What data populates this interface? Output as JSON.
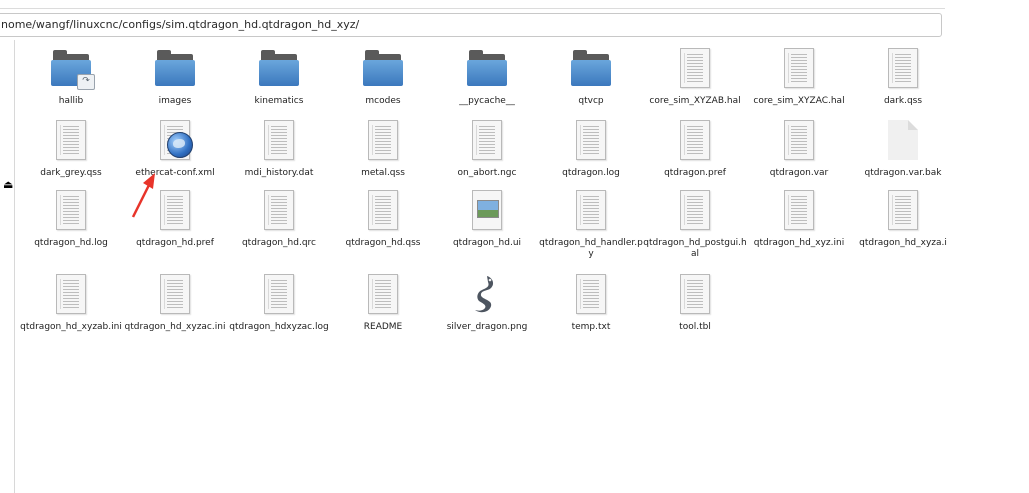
{
  "path": "nome/wangf/linuxcnc/configs/sim.qtdragon_hd.qtdragon_hd_xyz/",
  "sidebar": {
    "eject_symbol": "⏏"
  },
  "files": [
    {
      "name": "hallib",
      "icon": "folder-link-icon"
    },
    {
      "name": "images",
      "icon": "folder-icon"
    },
    {
      "name": "kinematics",
      "icon": "folder-icon"
    },
    {
      "name": "mcodes",
      "icon": "folder-icon"
    },
    {
      "name": "__pycache__",
      "icon": "folder-icon"
    },
    {
      "name": "qtvcp",
      "icon": "folder-icon"
    },
    {
      "name": "core_sim_XYZAB.hal",
      "icon": "text-file-icon"
    },
    {
      "name": "core_sim_XYZAC.hal",
      "icon": "text-file-icon"
    },
    {
      "name": "dark.qss",
      "icon": "text-file-icon"
    },
    {
      "name": "dark_grey.qss",
      "icon": "text-file-icon"
    },
    {
      "name": "ethercat-conf.xml",
      "icon": "xml-file-icon"
    },
    {
      "name": "mdi_history.dat",
      "icon": "text-file-icon"
    },
    {
      "name": "metal.qss",
      "icon": "text-file-icon"
    },
    {
      "name": "on_abort.ngc",
      "icon": "text-file-icon"
    },
    {
      "name": "qtdragon.log",
      "icon": "text-file-icon"
    },
    {
      "name": "qtdragon.pref",
      "icon": "text-file-icon"
    },
    {
      "name": "qtdragon.var",
      "icon": "text-file-icon"
    },
    {
      "name": "qtdragon.var.bak",
      "icon": "blank-file-icon"
    },
    {
      "name": "qtdragon_hd.log",
      "icon": "text-file-icon"
    },
    {
      "name": "qtdragon_hd.pref",
      "icon": "text-file-icon"
    },
    {
      "name": "qtdragon_hd.qrc",
      "icon": "text-file-icon"
    },
    {
      "name": "qtdragon_hd.qss",
      "icon": "text-file-icon"
    },
    {
      "name": "qtdragon_hd.ui",
      "icon": "image-file-icon"
    },
    {
      "name": "qtdragon_hd_handler.py",
      "icon": "text-file-icon"
    },
    {
      "name": "qtdragon_hd_postgui.hal",
      "icon": "text-file-icon"
    },
    {
      "name": "qtdragon_hd_xyz.ini",
      "icon": "text-file-icon"
    },
    {
      "name": "qtdragon_hd_xyza.i",
      "icon": "text-file-icon"
    },
    {
      "name": "qtdragon_hd_xyzab.ini",
      "icon": "text-file-icon"
    },
    {
      "name": "qtdragon_hd_xyzac.ini",
      "icon": "text-file-icon"
    },
    {
      "name": "qtdragon_hdxyzac.log",
      "icon": "text-file-icon"
    },
    {
      "name": "README",
      "icon": "text-file-icon"
    },
    {
      "name": "silver_dragon.png",
      "icon": "dragon-image-icon"
    },
    {
      "name": "temp.txt",
      "icon": "text-file-icon"
    },
    {
      "name": "tool.tbl",
      "icon": "text-file-icon"
    }
  ],
  "colors": {
    "folder_blue": "#3b78bd",
    "arrow_red": "#e8342a"
  }
}
